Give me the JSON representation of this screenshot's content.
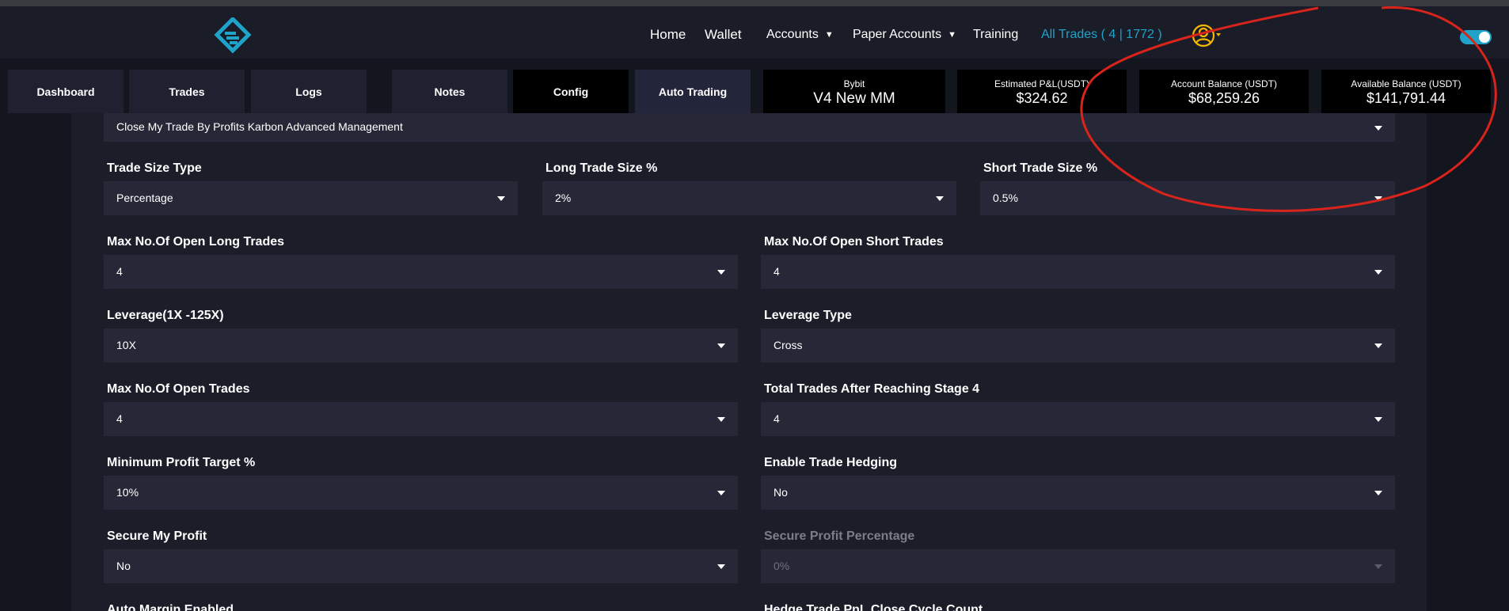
{
  "nav": {
    "home": "Home",
    "wallet": "Wallet",
    "accounts": "Accounts",
    "paper_accounts": "Paper Accounts",
    "training": "Training",
    "all_trades": "All Trades ( 4 | 1772 )",
    "logo_icon": "brand-logo-icon",
    "avatar_icon": "user-avatar-icon",
    "toggle_state": "on",
    "accent_color": "#1fa3c8",
    "avatar_color": "#f5b800"
  },
  "tabs": {
    "dashboard": "Dashboard",
    "trades": "Trades",
    "logs": "Logs",
    "notes": "Notes",
    "config": "Config",
    "auto_trading": "Auto Trading"
  },
  "stats": {
    "exchange_label": "Bybit",
    "exchange_value": "V4 New MM",
    "pnl_label": "Estimated P&L(USDT)",
    "pnl_value": "$324.62",
    "account_balance_label": "Account Balance (USDT)",
    "account_balance_value": "$68,259.26",
    "available_balance_label": "Available Balance (USDT)",
    "available_balance_value": "$141,791.44"
  },
  "form": {
    "close_trade": {
      "value": "Close My Trade By Profits Karbon Advanced Management"
    },
    "trade_size_type": {
      "label": "Trade Size Type",
      "value": "Percentage"
    },
    "long_trade_size": {
      "label": "Long Trade Size %",
      "value": "2%"
    },
    "short_trade_size": {
      "label": "Short Trade Size %",
      "value": "0.5%"
    },
    "max_open_long": {
      "label": "Max No.Of Open Long Trades",
      "value": "4"
    },
    "max_open_short": {
      "label": "Max No.Of Open Short Trades",
      "value": "4"
    },
    "leverage": {
      "label": "Leverage(1X -125X)",
      "value": "10X"
    },
    "leverage_type": {
      "label": "Leverage Type",
      "value": "Cross"
    },
    "max_open_trades": {
      "label": "Max No.Of Open Trades",
      "value": "4"
    },
    "total_after_stage4": {
      "label": "Total Trades After Reaching Stage 4",
      "value": "4"
    },
    "min_profit_target": {
      "label": "Minimum Profit Target %",
      "value": "10%"
    },
    "enable_hedging": {
      "label": "Enable Trade Hedging",
      "value": "No"
    },
    "secure_profit": {
      "label": "Secure My Profit",
      "value": "No"
    },
    "secure_profit_pct": {
      "label": "Secure Profit Percentage",
      "value": "0%"
    },
    "auto_margin": {
      "label": "Auto Margin Enabled"
    },
    "hedge_cycle": {
      "label": "Hedge Trade PnL Close Cycle Count"
    }
  }
}
